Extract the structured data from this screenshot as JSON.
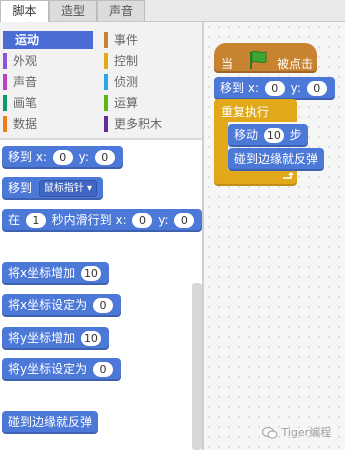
{
  "tabs": [
    {
      "label": "脚本",
      "active": true
    },
    {
      "label": "造型",
      "active": false
    },
    {
      "label": "声音",
      "active": false
    }
  ],
  "categories": {
    "left": [
      {
        "label": "运动",
        "color": "#4a6cd4",
        "active": true
      },
      {
        "label": "外观",
        "color": "#8a55d7"
      },
      {
        "label": "声音",
        "color": "#bb42c3"
      },
      {
        "label": "画笔",
        "color": "#0e9a6c"
      },
      {
        "label": "数据",
        "color": "#ee7d16"
      }
    ],
    "right": [
      {
        "label": "事件",
        "color": "#c88330"
      },
      {
        "label": "控制",
        "color": "#e1a91a"
      },
      {
        "label": "侦测",
        "color": "#2ca5e2"
      },
      {
        "label": "运算",
        "color": "#5cb712"
      },
      {
        "label": "更多积木",
        "color": "#632d99"
      }
    ]
  },
  "palette": {
    "goto_xy": {
      "text1": "移到 x:",
      "x": "0",
      "text2": "y:",
      "y": "0"
    },
    "goto_target": {
      "text": "移到",
      "dropdown": "鼠标指针 ▾"
    },
    "glide": {
      "text1": "在",
      "secs": "1",
      "text2": "秒内滑行到 x:",
      "x": "0",
      "text3": "y:",
      "y": "0"
    },
    "change_x": {
      "text": "将x坐标增加",
      "value": "10"
    },
    "set_x": {
      "text": "将x坐标设定为",
      "value": "0"
    },
    "change_y": {
      "text": "将y坐标增加",
      "value": "10"
    },
    "set_y": {
      "text": "将y坐标设定为",
      "value": "0"
    },
    "bounce": {
      "text": "碰到边缘就反弹"
    }
  },
  "script": {
    "hat": {
      "text1": "当",
      "text2": "被点击"
    },
    "goto_xy": {
      "text1": "移到 x:",
      "x": "0",
      "text2": "y:",
      "y": "0"
    },
    "forever": {
      "text": "重复执行"
    },
    "move": {
      "text1": "移动",
      "steps": "10",
      "text2": "步"
    },
    "bounce": {
      "text": "碰到边缘就反弹"
    }
  },
  "watermark": {
    "text": "Tiger编程"
  },
  "colors": {
    "motion": "#4c78d8",
    "events": "#c88330",
    "control": "#e1a91a",
    "flag": "#3fa535"
  }
}
